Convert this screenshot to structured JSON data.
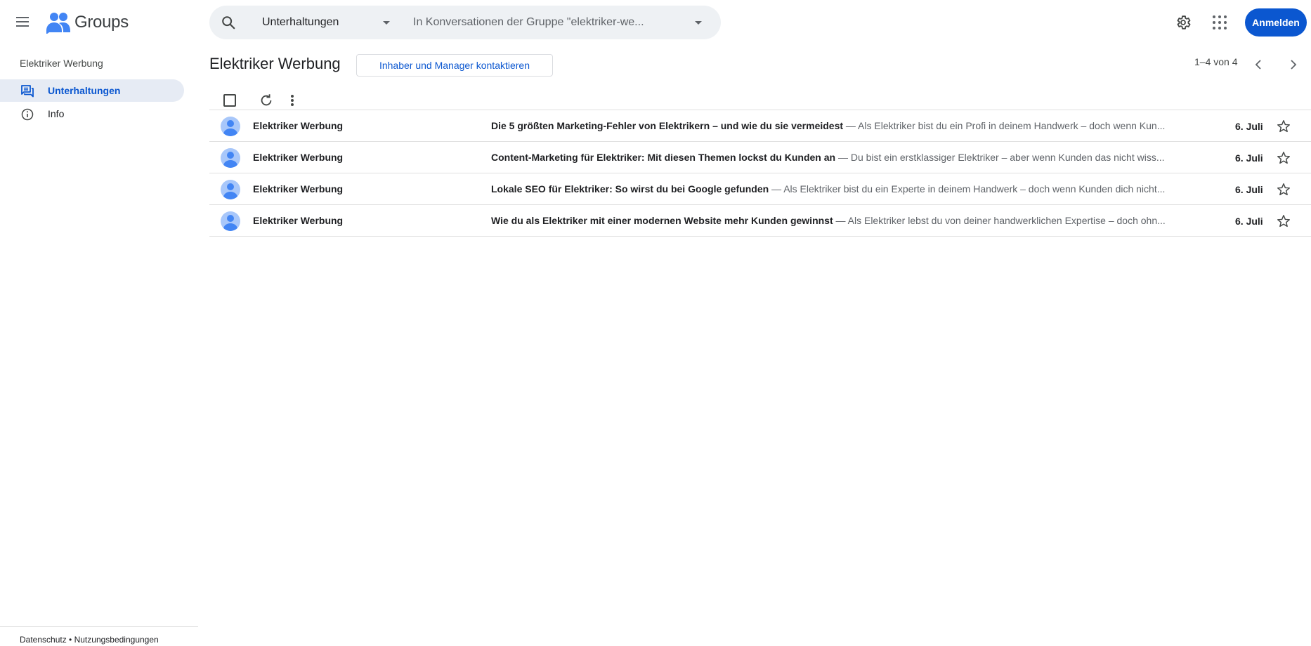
{
  "header": {
    "app_name": "Groups",
    "search_scope": "Unterhaltungen",
    "search_placeholder": "In Konversationen der Gruppe \"elektriker-we...",
    "signin_label": "Anmelden",
    "icons": [
      "menu-icon",
      "groups-logo-icon",
      "search-icon",
      "chevron-down-icon",
      "settings-gear-icon",
      "apps-grid-icon"
    ],
    "accent_color": "#0b57d0"
  },
  "sidebar": {
    "group_name": "Elektriker Werbung",
    "items": [
      {
        "label": "Unterhaltungen",
        "icon": "forum-icon",
        "active": true
      },
      {
        "label": "Info",
        "icon": "info-icon",
        "active": false
      }
    ],
    "footer": {
      "privacy": "Datenschutz",
      "separator": "•",
      "terms": "Nutzungsbedingungen"
    }
  },
  "main": {
    "title": "Elektriker Werbung",
    "contact_button": "Inhaber und Manager kontaktieren",
    "pagination": "1–4 von 4",
    "conversations": [
      {
        "sender": "Elektriker Werbung",
        "subject": "Die 5 größten Marketing-Fehler von Elektrikern – und wie du sie vermeidest",
        "separator": " — ",
        "snippet": "Als Elektriker bist du ein Profi in deinem Handwerk – doch wenn Kun...",
        "date": "6. Juli"
      },
      {
        "sender": "Elektriker Werbung",
        "subject": "Content-Marketing für Elektriker: Mit diesen Themen lockst du Kunden an",
        "separator": " — ",
        "snippet": "Du bist ein erstklassiger Elektriker – aber wenn Kunden das nicht wiss...",
        "date": "6. Juli"
      },
      {
        "sender": "Elektriker Werbung",
        "subject": "Lokale SEO für Elektriker: So wirst du bei Google gefunden",
        "separator": " — ",
        "snippet": "Als Elektriker bist du ein Experte in deinem Handwerk – doch wenn Kunden dich nicht...",
        "date": "6. Juli"
      },
      {
        "sender": "Elektriker Werbung",
        "subject": "Wie du als Elektriker mit einer modernen Website mehr Kunden gewinnst",
        "separator": " — ",
        "snippet": "Als Elektriker lebst du von deiner handwerklichen Expertise – doch ohn...",
        "date": "6. Juli"
      }
    ]
  }
}
